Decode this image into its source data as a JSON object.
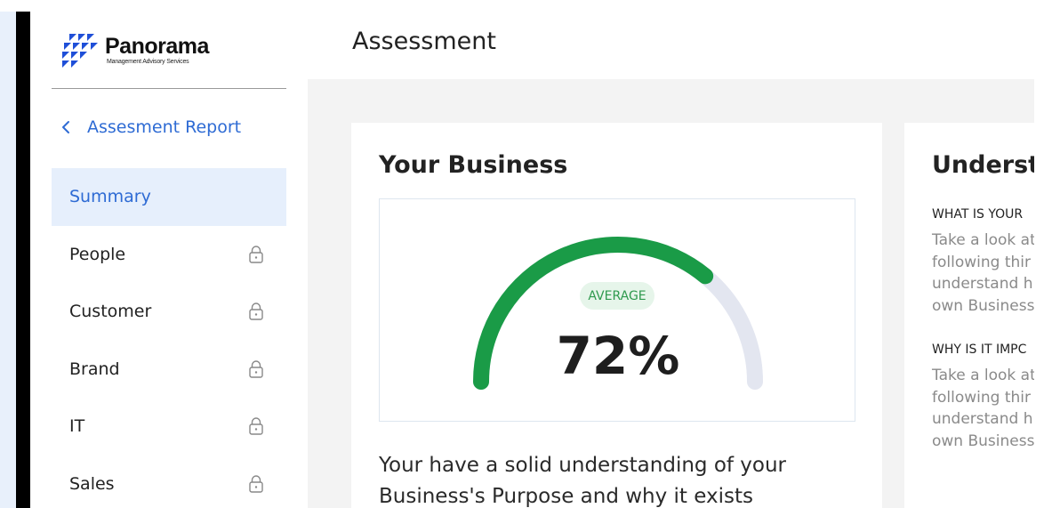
{
  "brand": {
    "name": "Panorama",
    "subtitle": "Management Advisory Services",
    "color": "#1f4fd8"
  },
  "back_link": {
    "label": "Assesment Report"
  },
  "nav": [
    {
      "label": "Summary",
      "active": true,
      "locked": false
    },
    {
      "label": "People",
      "active": false,
      "locked": true
    },
    {
      "label": "Customer",
      "active": false,
      "locked": true
    },
    {
      "label": "Brand",
      "active": false,
      "locked": true
    },
    {
      "label": "IT",
      "active": false,
      "locked": true
    },
    {
      "label": "Sales",
      "active": false,
      "locked": true
    }
  ],
  "header": {
    "title": "Assessment"
  },
  "business_card": {
    "title": "Your Business",
    "rating": "AVERAGE",
    "score": "72%",
    "score_fraction": 0.72,
    "description": "Your have a solid understanding of your Business's Purpose and why it exists"
  },
  "understand_card": {
    "title": "Understa",
    "sections": [
      {
        "label": "WHAT IS YOUR",
        "lines": [
          "Take a look at",
          "following thir",
          "understand h",
          "own Business"
        ]
      },
      {
        "label": "WHY IS IT IMPC",
        "lines": [
          "Take a look at",
          "following thir",
          "understand h",
          "own Business"
        ]
      }
    ]
  },
  "colors": {
    "accent": "#2e6bd4",
    "active_bg": "#e6effc",
    "gauge_fill": "#1a9b47",
    "gauge_track": "#e3e6f0",
    "badge_bg": "#e6f5ea",
    "badge_text": "#2f9a4e"
  }
}
